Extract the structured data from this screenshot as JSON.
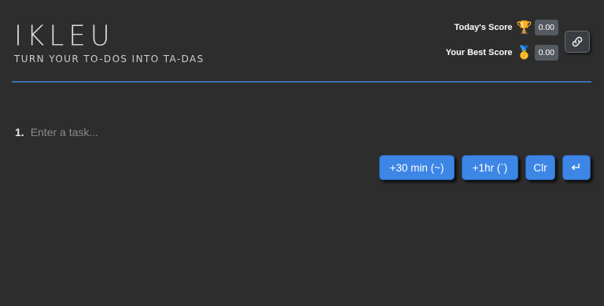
{
  "brand": {
    "logo": "IKLEU",
    "tagline": "TURN YOUR TO-DOS INTO TA-DAS"
  },
  "scores": {
    "today_label": "Today's Score",
    "today_icon": "trophy-icon",
    "today_emoji": "🏆",
    "today_value": "0.00",
    "best_label": "Your Best Score",
    "best_icon": "medal-icon",
    "best_emoji": "🥇",
    "best_value": "0.00"
  },
  "toolbar": {
    "link_icon": "link-icon"
  },
  "task": {
    "number": "1.",
    "placeholder": "Enter a task..."
  },
  "actions": {
    "add30_label": "+30 min (~)",
    "add1h_label": "+1hr (`)",
    "clear_label": "Clr",
    "enter_label": "↵"
  },
  "colors": {
    "background": "#2d2d2d",
    "accent": "#3d86e6",
    "divider": "#3b6fae"
  }
}
